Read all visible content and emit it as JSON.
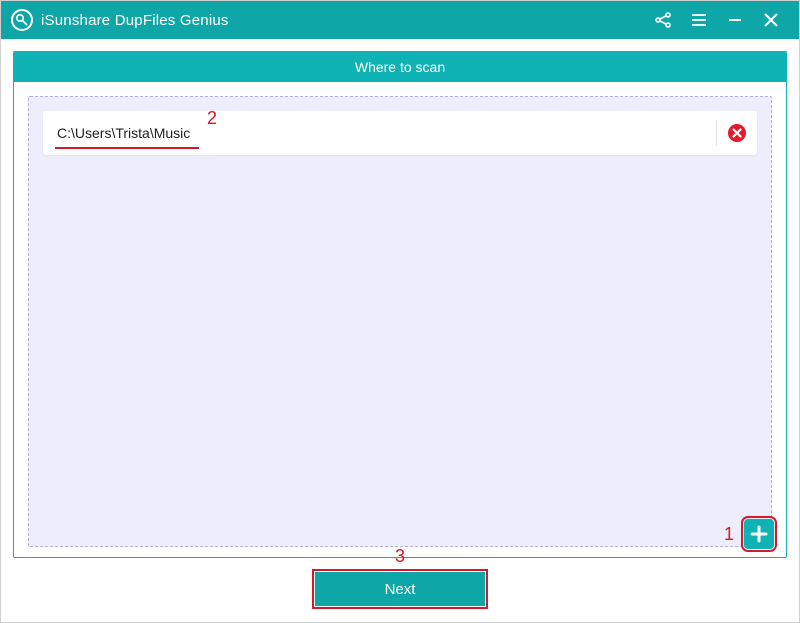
{
  "window": {
    "title": "iSunshare DupFiles Genius"
  },
  "panel": {
    "header": "Where to scan",
    "paths": [
      {
        "path": "C:\\Users\\Trista\\Music"
      }
    ]
  },
  "buttons": {
    "next": "Next"
  },
  "annotations": {
    "add": "1",
    "path": "2",
    "next": "3"
  }
}
